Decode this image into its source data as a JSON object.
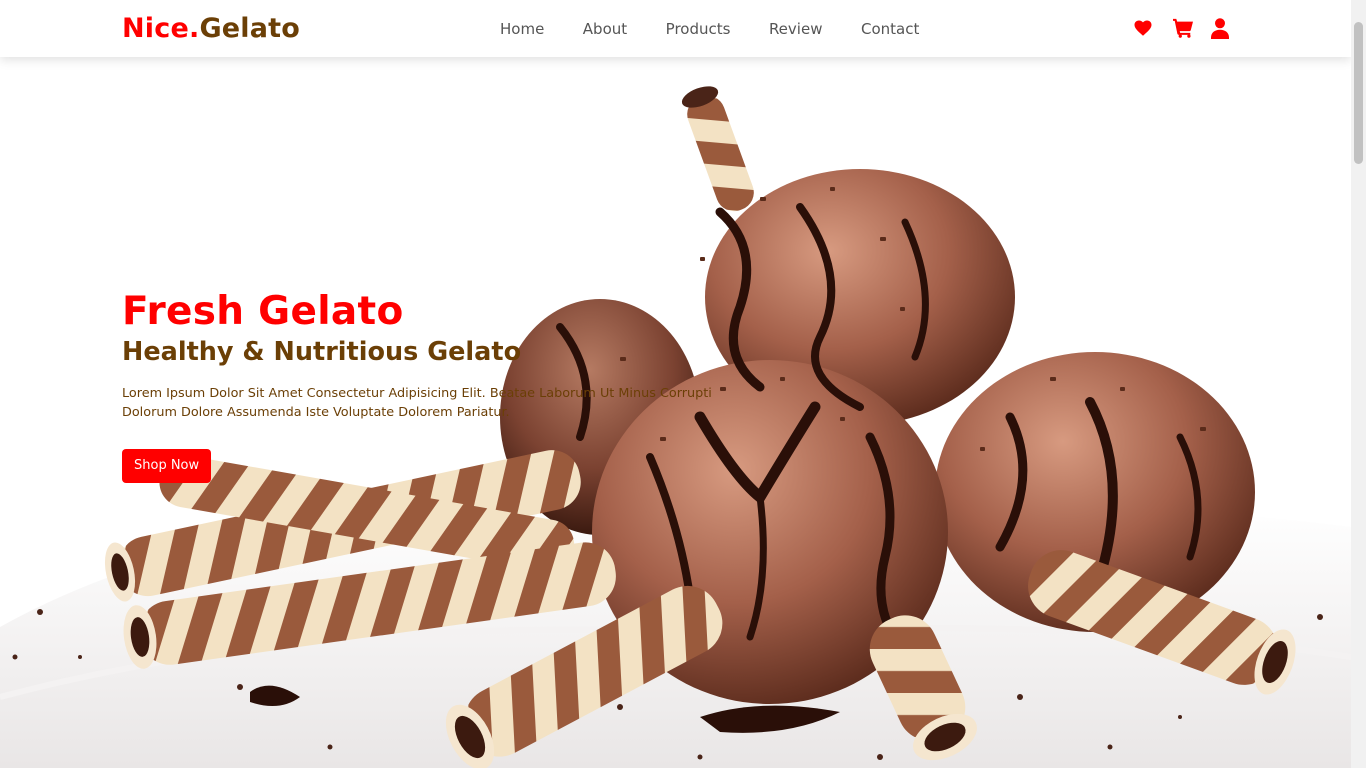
{
  "brand": {
    "part1": "Nice.",
    "part2": "Gelato"
  },
  "nav": [
    {
      "label": "Home"
    },
    {
      "label": "About"
    },
    {
      "label": "Products"
    },
    {
      "label": "Review"
    },
    {
      "label": "Contact"
    }
  ],
  "header_icons": [
    "heart-icon",
    "cart-icon",
    "user-icon"
  ],
  "hero": {
    "title": "Fresh Gelato",
    "subtitle": "Healthy & Nutritious Gelato",
    "description": "Lorem Ipsum Dolor Sit Amet Consectetur Adipisicing Elit. Beatae Laborum Ut Minus Corrupti Dolorum Dolore Assumenda Iste Voluptate Dolorem Pariatur.",
    "cta_label": "Shop Now"
  },
  "colors": {
    "accent": "#ff0000",
    "brand_brown": "#6b3f06",
    "nav_text": "#555555"
  }
}
